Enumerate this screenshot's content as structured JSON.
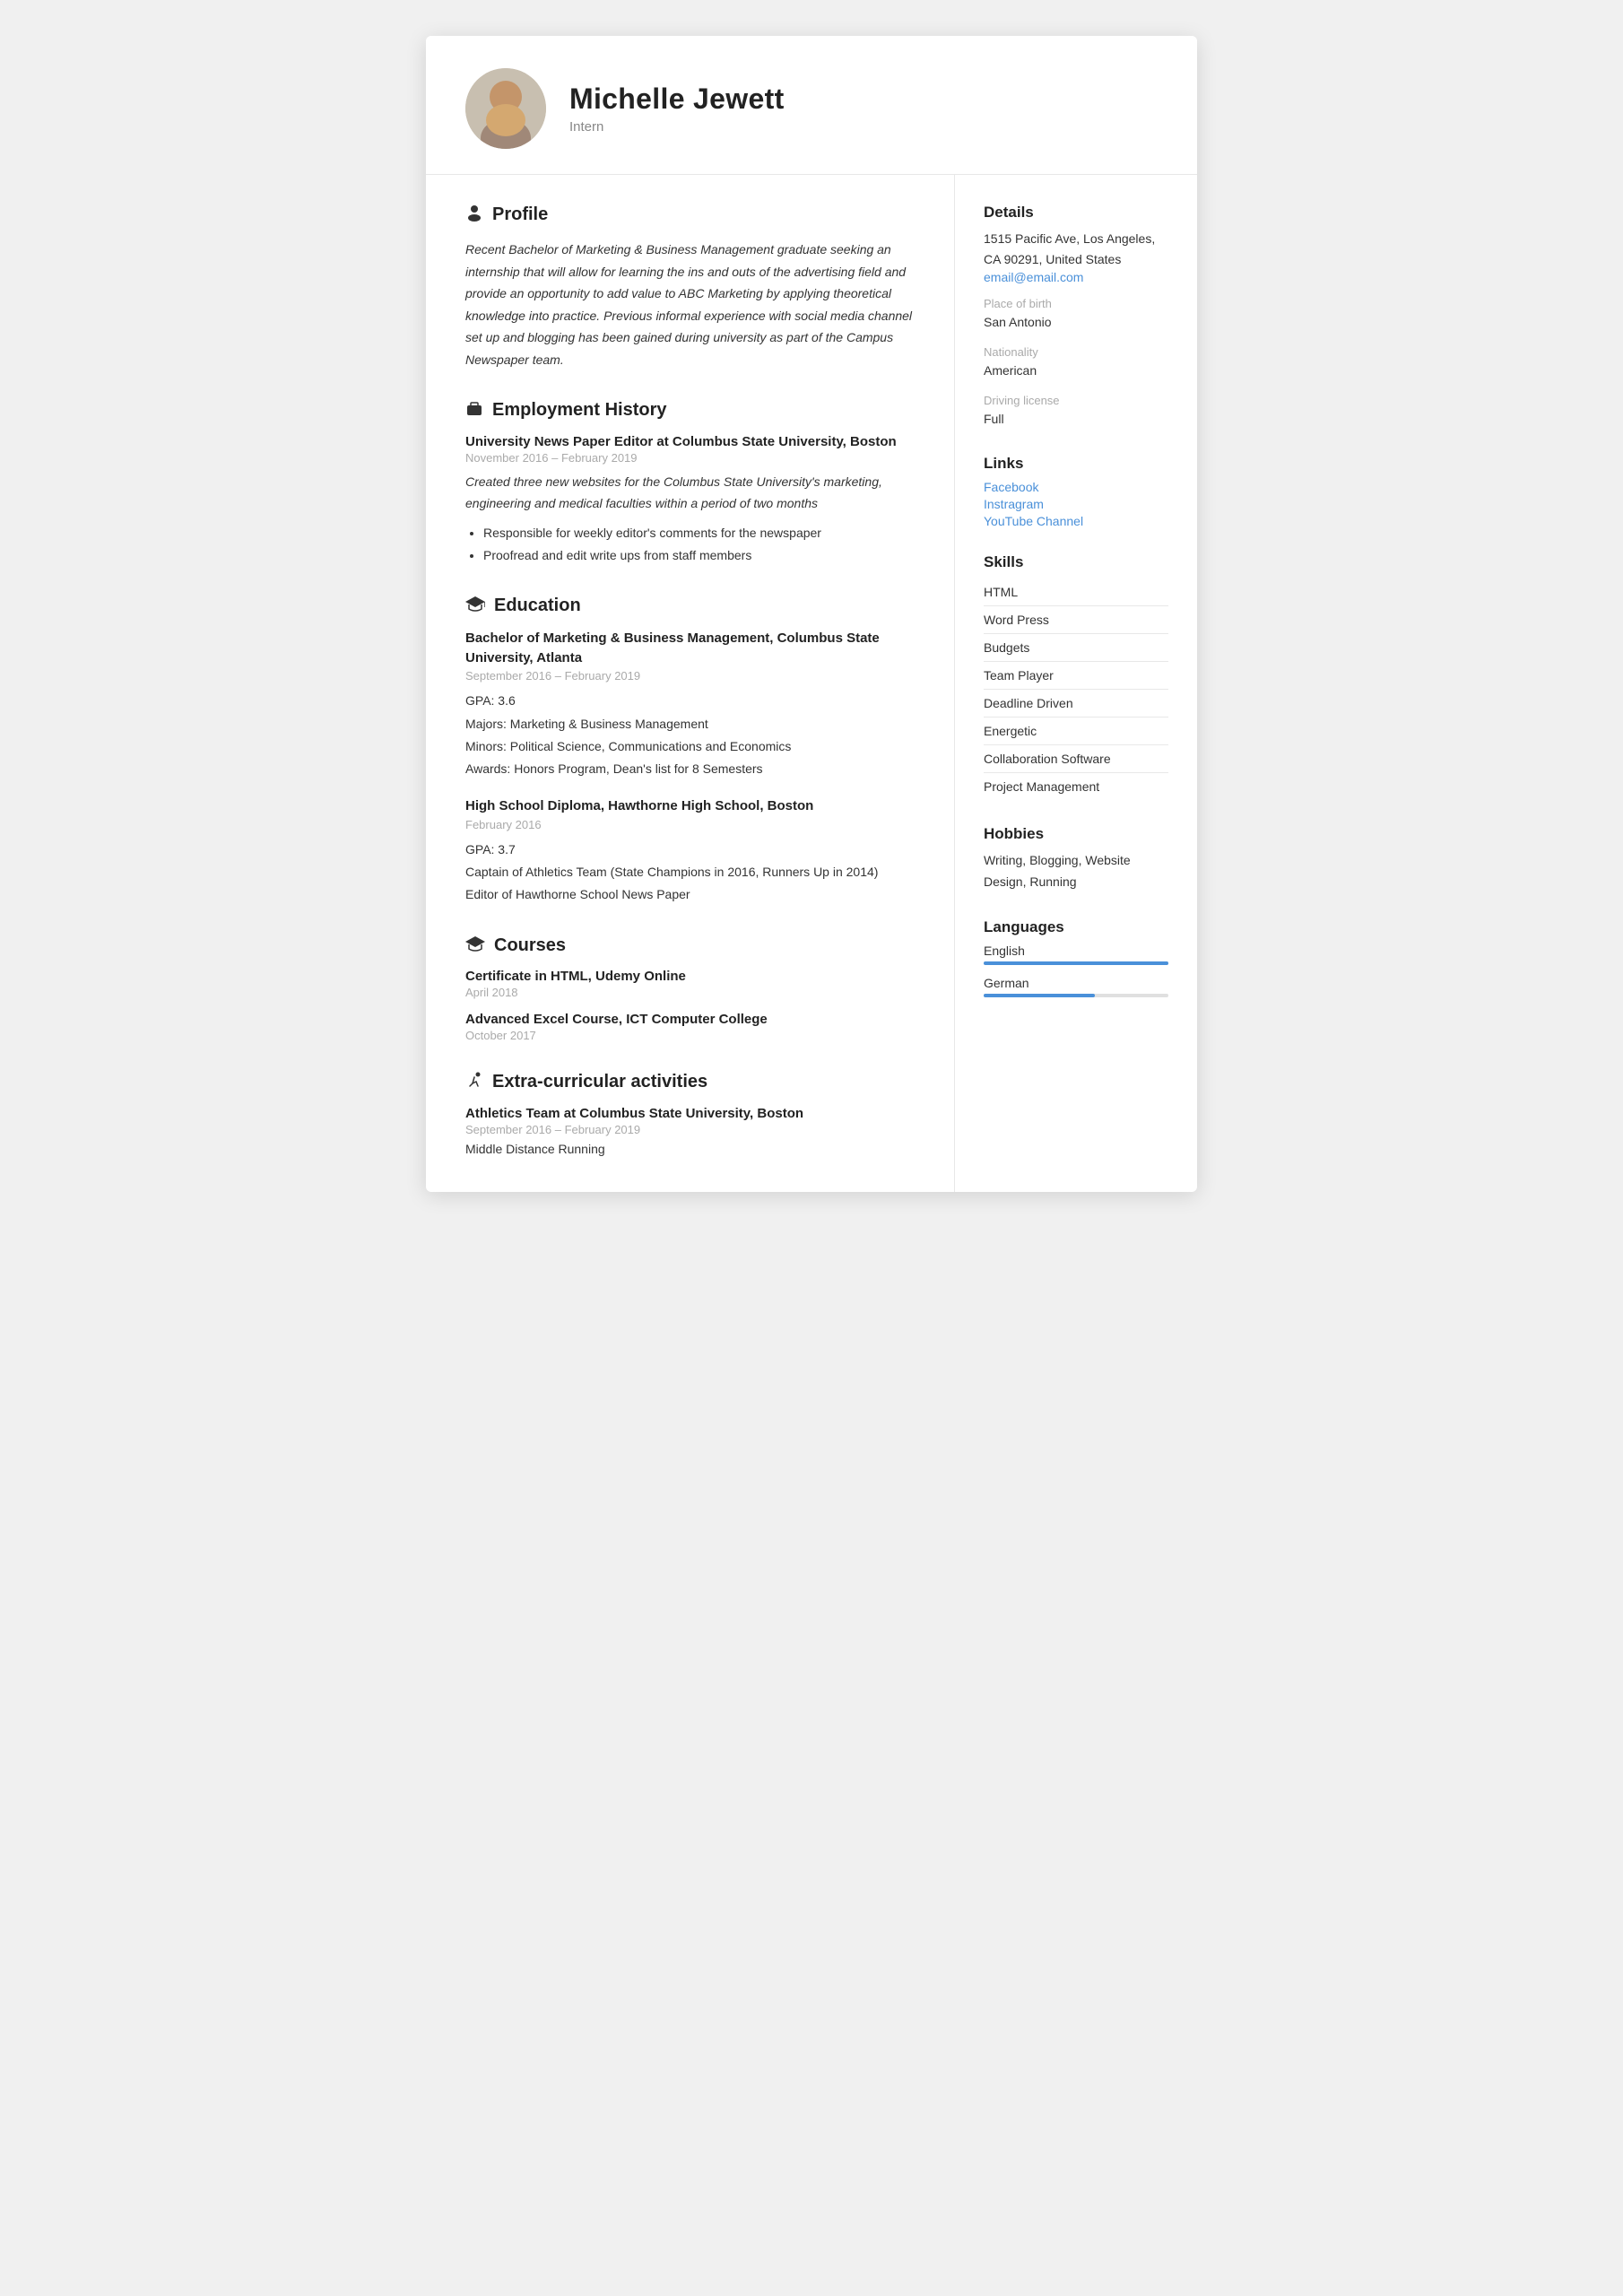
{
  "header": {
    "name": "Michelle Jewett",
    "title": "Intern"
  },
  "profile": {
    "section_label": "Profile",
    "text": "Recent Bachelor of Marketing & Business Management graduate seeking an internship that will allow for learning the ins and outs of the advertising field and provide an opportunity to add value to ABC Marketing by applying theoretical knowledge into practice. Previous informal experience with social media channel set up and blogging has been gained during university as part of the Campus Newspaper team."
  },
  "employment": {
    "section_label": "Employment History",
    "jobs": [
      {
        "title": "University News Paper Editor at Columbus State University, Boston",
        "dates": "November 2016 – February 2019",
        "desc": "Created three new websites for the Columbus State University's marketing, engineering and medical faculties within a period of two months",
        "bullets": [
          "Responsible for weekly editor's comments for the newspaper",
          "Proofread and edit write ups from staff members"
        ]
      }
    ]
  },
  "education": {
    "section_label": "Education",
    "items": [
      {
        "degree": "Bachelor of Marketing & Business Management, Columbus State University, Atlanta",
        "dates": "September 2016 – February 2019",
        "details": [
          "GPA: 3.6",
          "Majors: Marketing & Business Management",
          "Minors: Political Science, Communications and Economics",
          "Awards: Honors Program, Dean's list for 8 Semesters"
        ]
      },
      {
        "degree": "High School Diploma, Hawthorne High School, Boston",
        "dates": "February 2016",
        "details": [
          "GPA: 3.7",
          "Captain of Athletics Team (State Champions in 2016, Runners Up in 2014)",
          "Editor of Hawthorne School News Paper"
        ]
      }
    ]
  },
  "courses": {
    "section_label": "Courses",
    "items": [
      {
        "title": "Certificate in HTML, Udemy Online",
        "date": "April 2018"
      },
      {
        "title": "Advanced Excel Course, ICT Computer College",
        "date": "October 2017"
      }
    ]
  },
  "extracurricular": {
    "section_label": "Extra-curricular activities",
    "items": [
      {
        "title": "Athletics Team at Columbus State University, Boston",
        "dates": "September 2016 – February 2019",
        "desc": "Middle Distance Running"
      }
    ]
  },
  "details": {
    "section_label": "Details",
    "address": "1515 Pacific Ave, Los Angeles, CA 90291, United States",
    "email": "email@email.com",
    "place_of_birth_label": "Place of birth",
    "place_of_birth": "San Antonio",
    "nationality_label": "Nationality",
    "nationality": "American",
    "driving_license_label": "Driving license",
    "driving_license": "Full"
  },
  "links": {
    "section_label": "Links",
    "items": [
      {
        "label": "Facebook",
        "url": "#"
      },
      {
        "label": "Instragram",
        "url": "#"
      },
      {
        "label": "YouTube Channel",
        "url": "#"
      }
    ]
  },
  "skills": {
    "section_label": "Skills",
    "items": [
      "HTML",
      "Word Press",
      "Budgets",
      "Team Player",
      "Deadline Driven",
      "Energetic",
      "Collaboration Software",
      "Project Management"
    ]
  },
  "hobbies": {
    "section_label": "Hobbies",
    "text": "Writing, Blogging, Website Design, Running"
  },
  "languages": {
    "section_label": "Languages",
    "items": [
      {
        "name": "English",
        "level": 100
      },
      {
        "name": "German",
        "level": 60
      }
    ]
  },
  "icons": {
    "profile": "👤",
    "employment": "💼",
    "education": "🎓",
    "extracurricular": "🏃"
  }
}
